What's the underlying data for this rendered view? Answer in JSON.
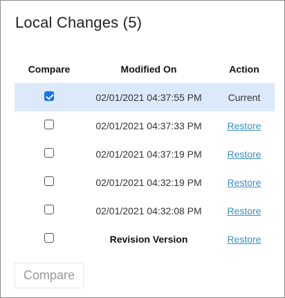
{
  "title": "Local Changes (5)",
  "columns": {
    "compare": "Compare",
    "modified": "Modified On",
    "action": "Action"
  },
  "rows": [
    {
      "checked": true,
      "modified": "02/01/2021 04:37:55 PM",
      "action": "Current",
      "action_is_link": false,
      "selected": true,
      "bold": false
    },
    {
      "checked": false,
      "modified": "02/01/2021 04:37:33 PM",
      "action": "Restore",
      "action_is_link": true,
      "selected": false,
      "bold": false
    },
    {
      "checked": false,
      "modified": "02/01/2021 04:37:19 PM",
      "action": "Restore",
      "action_is_link": true,
      "selected": false,
      "bold": false
    },
    {
      "checked": false,
      "modified": "02/01/2021 04:32:19 PM",
      "action": "Restore",
      "action_is_link": true,
      "selected": false,
      "bold": false
    },
    {
      "checked": false,
      "modified": "02/01/2021 04:32:08 PM",
      "action": "Restore",
      "action_is_link": true,
      "selected": false,
      "bold": false
    },
    {
      "checked": false,
      "modified": "Revision Version",
      "action": "Restore",
      "action_is_link": true,
      "selected": false,
      "bold": true
    }
  ],
  "compare_button": {
    "label": "Compare",
    "disabled": true
  },
  "colors": {
    "selected_row": "#dbe9fb",
    "link": "#3a8fc2",
    "checkbox": "#1a73e8"
  }
}
